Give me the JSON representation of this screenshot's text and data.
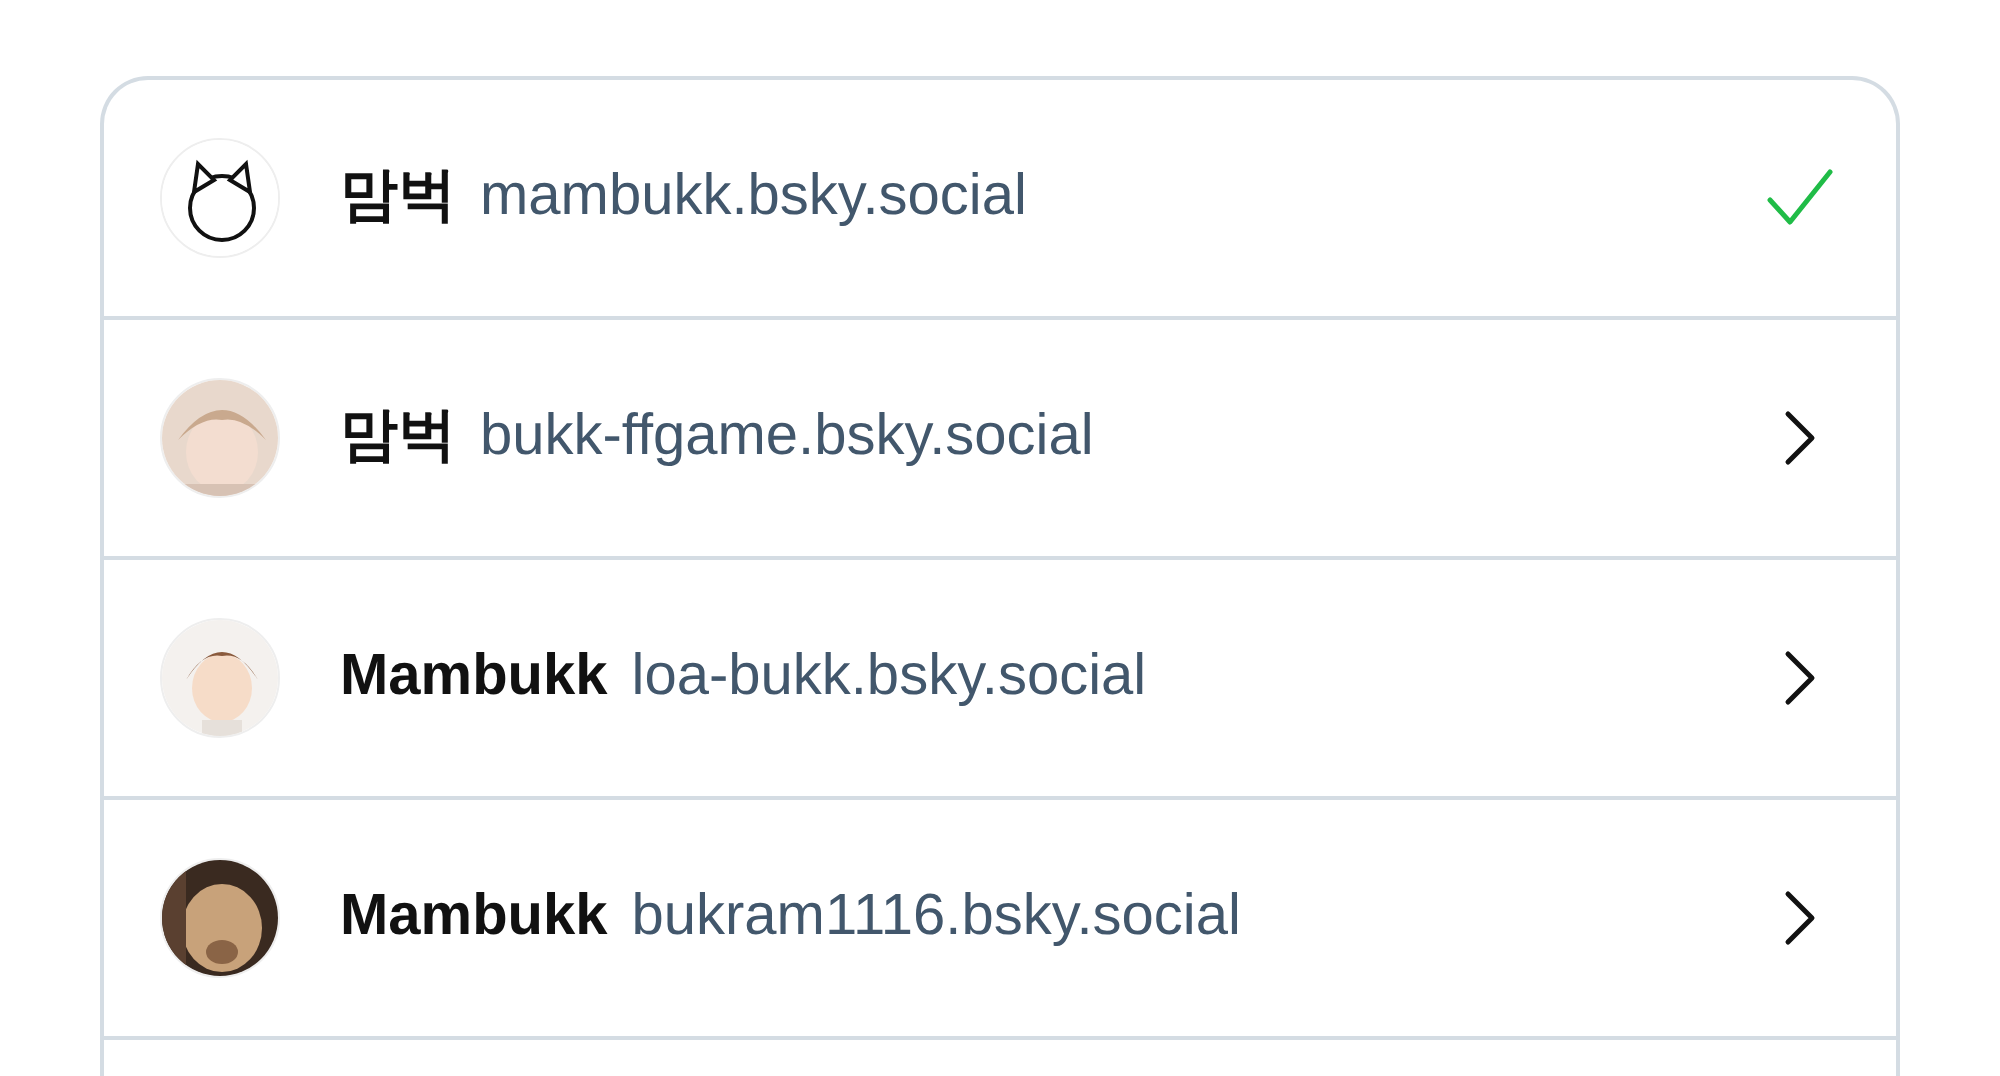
{
  "accounts": [
    {
      "display_name": "맘벅",
      "handle": "mambukk.bsky.social",
      "selected": true
    },
    {
      "display_name": "맘벅",
      "handle": "bukk-ffgame.bsky.social",
      "selected": false
    },
    {
      "display_name": "Mambukk",
      "handle": "loa-bukk.bsky.social",
      "selected": false
    },
    {
      "display_name": "Mambukk",
      "handle": "bukram1116.bsky.social",
      "selected": false
    }
  ]
}
